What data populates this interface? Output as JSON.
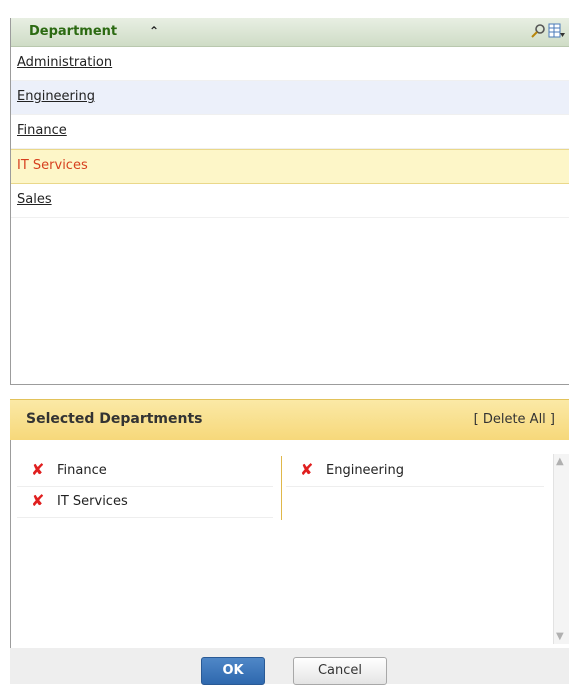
{
  "list": {
    "header_title": "Department",
    "sort_icon": "double-chevron-up",
    "rows": [
      {
        "label": "Administration"
      },
      {
        "label": "Engineering"
      },
      {
        "label": "Finance"
      },
      {
        "label": "IT Services"
      },
      {
        "label": "Sales"
      }
    ]
  },
  "selected": {
    "title": "Selected Departments",
    "delete_all": "[ Delete All ]",
    "left_items": [
      {
        "label": "Finance"
      },
      {
        "label": "IT Services"
      }
    ],
    "right_items": [
      {
        "label": "Engineering"
      }
    ],
    "remove_glyph": "✘"
  },
  "footer": {
    "ok_label": "OK",
    "cancel_label": "Cancel"
  },
  "colors": {
    "header_green": "#2c6a12",
    "highlight_row": "#fdf6c8",
    "highlight_text": "#d6401f",
    "selected_header": "#f6d87a",
    "ok_blue": "#2e68ae",
    "remove_red": "#e01f1f"
  }
}
